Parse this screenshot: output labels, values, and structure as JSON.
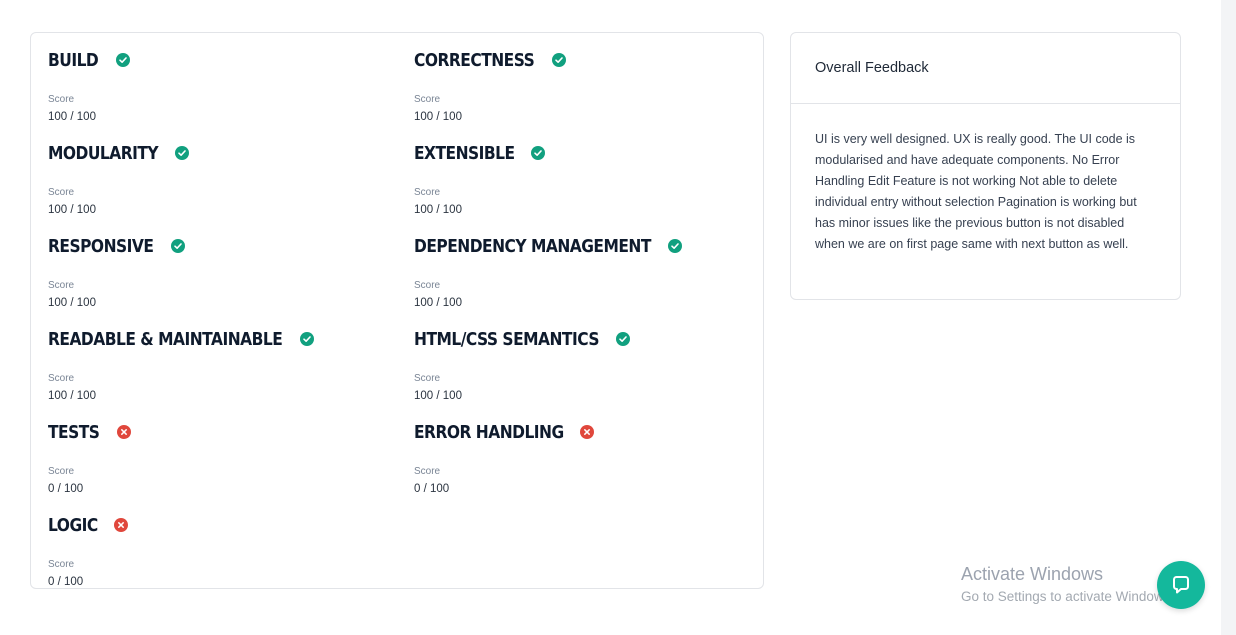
{
  "scores": [
    {
      "name": "BUILD",
      "score_label": "Score",
      "score": "100 / 100",
      "status": "pass"
    },
    {
      "name": "CORRECTNESS",
      "score_label": "Score",
      "score": "100 / 100",
      "status": "pass"
    },
    {
      "name": "MODULARITY",
      "score_label": "Score",
      "score": "100 / 100",
      "status": "pass"
    },
    {
      "name": "EXTENSIBLE",
      "score_label": "Score",
      "score": "100 / 100",
      "status": "pass"
    },
    {
      "name": "RESPONSIVE",
      "score_label": "Score",
      "score": "100 / 100",
      "status": "pass"
    },
    {
      "name": "DEPENDENCY MANAGEMENT",
      "score_label": "Score",
      "score": "100 / 100",
      "status": "pass"
    },
    {
      "name": "READABLE & MAINTAINABLE",
      "score_label": "Score",
      "score": "100 / 100",
      "status": "pass"
    },
    {
      "name": "HTML/CSS SEMANTICS",
      "score_label": "Score",
      "score": "100 / 100",
      "status": "pass"
    },
    {
      "name": "TESTS",
      "score_label": "Score",
      "score": "0 / 100",
      "status": "fail"
    },
    {
      "name": "ERROR HANDLING",
      "score_label": "Score",
      "score": "0 / 100",
      "status": "fail"
    },
    {
      "name": "LOGIC",
      "score_label": "Score",
      "score": "0 / 100",
      "status": "fail"
    }
  ],
  "feedback": {
    "title": "Overall Feedback",
    "body": "UI is very well designed. UX is really good. The UI code is modularised and have adequate components. No Error Handling Edit Feature is not working Not able to delete individual entry without selection Pagination is working but has minor issues like the previous button is not disabled when we are on first page same with next button as well."
  },
  "watermark": {
    "title": "Activate Windows",
    "subtitle": "Go to Settings to activate Windows."
  },
  "icons": {
    "pass": "check-circle-icon",
    "fail": "x-circle-icon",
    "help": "chat-bubble-icon"
  },
  "colors": {
    "pass": "#11a07f",
    "fail": "#e0473c",
    "help_button": "#14b89c"
  }
}
